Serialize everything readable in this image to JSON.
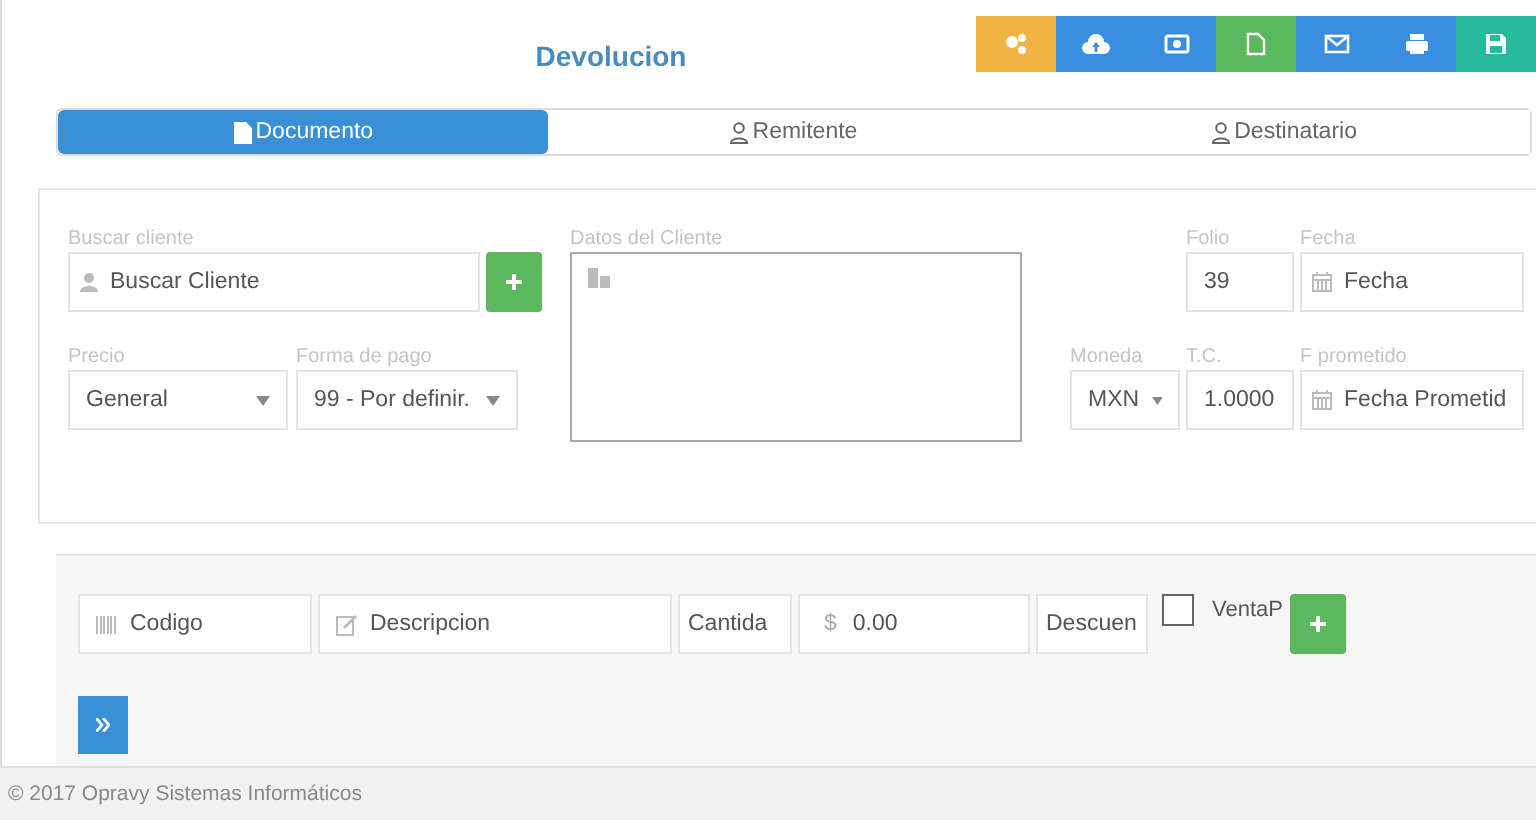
{
  "header": {
    "title": "Devolucion"
  },
  "toolbar": [
    {
      "kind": "share",
      "color": "#f0b443"
    },
    {
      "kind": "upload",
      "color": "#3a8ee0"
    },
    {
      "kind": "money",
      "color": "#3a8ee0"
    },
    {
      "kind": "file",
      "color": "#5cb85c"
    },
    {
      "kind": "mail",
      "color": "#3a8ee0"
    },
    {
      "kind": "print",
      "color": "#3a8ee0"
    },
    {
      "kind": "save",
      "color": "#26b99a"
    }
  ],
  "tabs": [
    {
      "label": "Documento",
      "kind": "file",
      "selected": true
    },
    {
      "label": "Remitente",
      "kind": "user",
      "selected": false
    },
    {
      "label": "Destinatario",
      "kind": "user",
      "selected": false
    }
  ],
  "client": {
    "search": {
      "label": "Buscar cliente",
      "placeholder": "Buscar Cliente"
    },
    "details": {
      "label": "Datos del Cliente"
    },
    "price": {
      "label": "Precio",
      "value": "General"
    },
    "payment": {
      "label": "Forma de pago",
      "value": "99 - Por definir."
    },
    "folio": {
      "label": "Folio",
      "value": "39"
    },
    "date": {
      "label": "Fecha",
      "placeholder": "Fecha"
    },
    "currency": {
      "label": "Moneda",
      "value": "MXN"
    },
    "rate": {
      "label": "T.C.",
      "value": "1.0000"
    },
    "promised": {
      "label": "F prometido",
      "placeholder": "Fecha Prometid"
    }
  },
  "item": {
    "code": {
      "placeholder": "Codigo"
    },
    "description": {
      "placeholder": "Descripcion"
    },
    "quantity": {
      "placeholder": "Cantida"
    },
    "price": {
      "prefix": "$",
      "placeholder": "0.00"
    },
    "discount": {
      "placeholder": "Descuen"
    },
    "sale": {
      "label": "VentaP",
      "checked": false
    }
  },
  "footer": {
    "text": "© 2017 Opravy Sistemas Informáticos"
  }
}
